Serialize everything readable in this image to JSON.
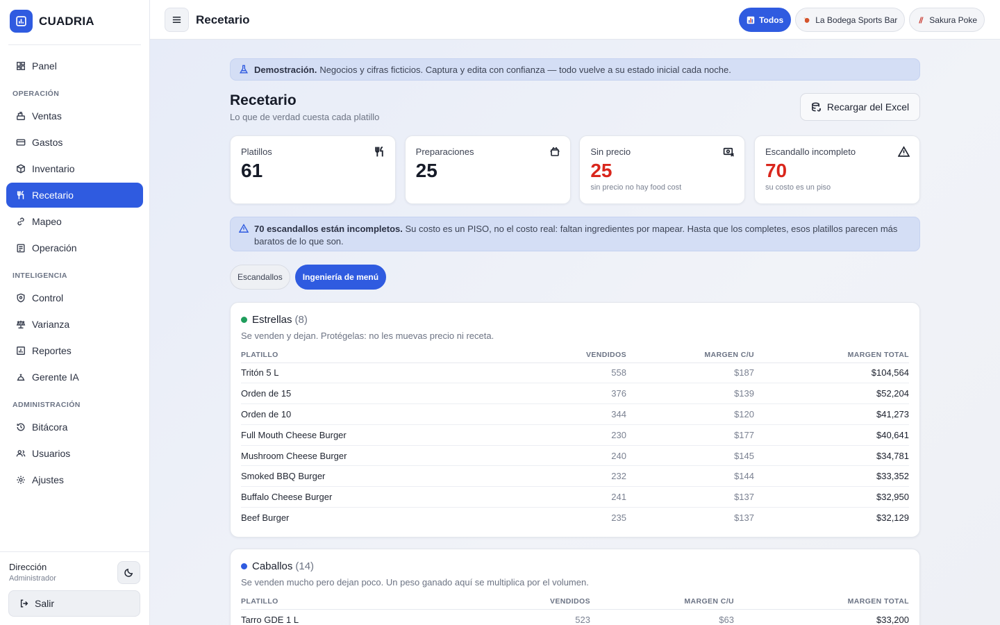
{
  "brand": {
    "name": "CUADRIA"
  },
  "sidebar": {
    "top_item": {
      "label": "Panel",
      "icon": "dashboard-icon"
    },
    "sections": [
      {
        "title": "OPERACIÓN",
        "items": [
          {
            "label": "Ventas",
            "icon": "register-icon"
          },
          {
            "label": "Gastos",
            "icon": "card-icon"
          },
          {
            "label": "Inventario",
            "icon": "box-icon"
          },
          {
            "label": "Recetario",
            "icon": "utensils-icon",
            "active": true
          },
          {
            "label": "Mapeo",
            "icon": "link-icon"
          },
          {
            "label": "Operación",
            "icon": "clipboard-icon"
          }
        ]
      },
      {
        "title": "INTELIGENCIA",
        "items": [
          {
            "label": "Control",
            "icon": "shield-icon"
          },
          {
            "label": "Varianza",
            "icon": "scale-icon"
          },
          {
            "label": "Reportes",
            "icon": "chart-icon"
          },
          {
            "label": "Gerente IA",
            "icon": "bot-icon"
          }
        ]
      },
      {
        "title": "ADMINISTRACIÓN",
        "items": [
          {
            "label": "Bitácora",
            "icon": "history-icon"
          },
          {
            "label": "Usuarios",
            "icon": "users-icon"
          },
          {
            "label": "Ajustes",
            "icon": "gear-icon"
          }
        ]
      }
    ],
    "user": {
      "name": "Dirección",
      "role": "Administrador"
    },
    "logout_label": "Salir"
  },
  "topbar": {
    "title": "Recetario",
    "tabs": [
      {
        "label": "Todos",
        "active": true
      },
      {
        "label": "La Bodega Sports Bar"
      },
      {
        "label": "Sakura Poke"
      }
    ]
  },
  "demo_banner": {
    "bold": "Demostración.",
    "text": "Negocios y cifras ficticios. Captura y edita con confianza — todo vuelve a su estado inicial cada noche."
  },
  "page": {
    "title": "Recetario",
    "subtitle": "Lo que de verdad cuesta cada platillo",
    "reload_label": "Recargar del Excel"
  },
  "stats": [
    {
      "label": "Platillos",
      "value": "61",
      "hint": "",
      "icon": "utensils-icon"
    },
    {
      "label": "Preparaciones",
      "value": "25",
      "hint": "",
      "icon": "pot-icon"
    },
    {
      "label": "Sin precio",
      "value": "25",
      "hint": "sin precio no hay food cost",
      "icon": "price-off-icon",
      "alert": true
    },
    {
      "label": "Escandallo incompleto",
      "value": "70",
      "hint": "su costo es un piso",
      "icon": "warning-icon",
      "alert": true
    }
  ],
  "warning_banner": {
    "bold": "70 escandallos están incompletos.",
    "text": "Su costo es un PISO, no el costo real: faltan ingredientes por mapear. Hasta que los completes, esos platillos parecen más baratos de lo que son."
  },
  "segments": [
    {
      "label": "Escandallos"
    },
    {
      "label": "Ingeniería de menú",
      "active": true
    }
  ],
  "columns": [
    "PLATILLO",
    "VENDIDOS",
    "MARGEN C/U",
    "MARGEN TOTAL"
  ],
  "groups": [
    {
      "name": "Estrellas",
      "count": "(8)",
      "color": "#1f9d5c",
      "desc": "Se venden y dejan. Protégelas: no les muevas precio ni receta.",
      "rows": [
        [
          "Tritón 5 L",
          "558",
          "$187",
          "$104,564"
        ],
        [
          "Orden de 15",
          "376",
          "$139",
          "$52,204"
        ],
        [
          "Orden de 10",
          "344",
          "$120",
          "$41,273"
        ],
        [
          "Full Mouth Cheese Burger",
          "230",
          "$177",
          "$40,641"
        ],
        [
          "Mushroom Cheese Burger",
          "240",
          "$145",
          "$34,781"
        ],
        [
          "Smoked BBQ Burger",
          "232",
          "$144",
          "$33,352"
        ],
        [
          "Buffalo Cheese Burger",
          "241",
          "$137",
          "$32,950"
        ],
        [
          "Beef Burger",
          "235",
          "$137",
          "$32,129"
        ]
      ]
    },
    {
      "name": "Caballos",
      "count": "(14)",
      "color": "#2f5be0",
      "desc": "Se venden mucho pero dejan poco. Un peso ganado aquí se multiplica por el volumen.",
      "rows": [
        [
          "Tarro GDE 1 L",
          "523",
          "$63",
          "$33,200"
        ]
      ]
    }
  ]
}
